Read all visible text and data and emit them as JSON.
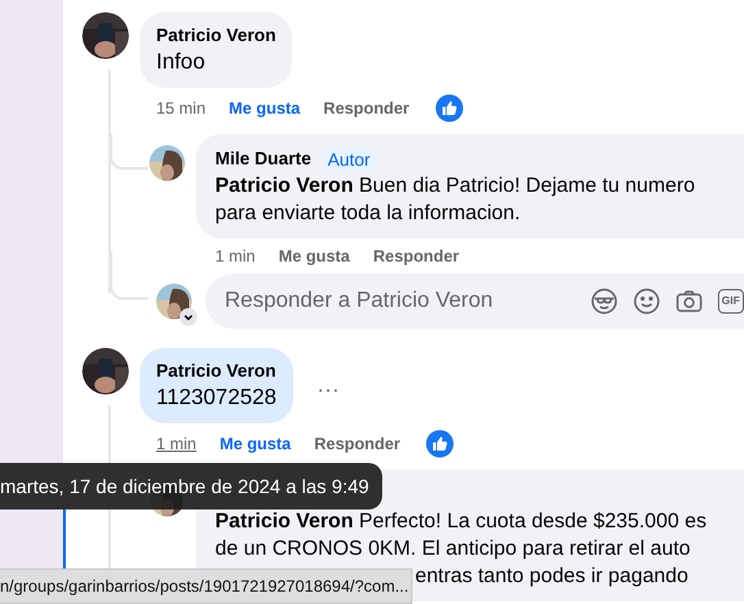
{
  "comments": [
    {
      "author": "Patricio Veron",
      "text": "Infoo",
      "highlighted": false,
      "time": "15 min",
      "time_hovered": false,
      "like_label": "Me gusta",
      "liked": true,
      "reply_label": "Responder",
      "reaction": true,
      "replies": [
        {
          "author": "Mile Duarte",
          "badge": "Autor",
          "lines": [
            "**Patricio Veron** Buen dia Patricio! Dejame tu numero",
            "para enviarte toda la informacion."
          ],
          "time": "1 min",
          "like_label": "Me gusta",
          "liked": false,
          "reply_label": "Responder"
        }
      ],
      "reply_field": {
        "placeholder": "Responder a Patricio Veron",
        "icons": [
          {
            "kind": "sticker"
          },
          {
            "kind": "emoji"
          },
          {
            "kind": "camera"
          },
          {
            "kind": "gif",
            "label": "GIF"
          }
        ]
      }
    },
    {
      "author": "Patricio Veron",
      "text": "1123072528",
      "highlighted": true,
      "more_label": "...",
      "time": "1 min",
      "time_hovered": true,
      "like_label": "Me gusta",
      "liked": true,
      "reply_label": "Responder",
      "reaction": true,
      "replies": [
        {
          "lines": [
            "**Patricio Veron** Perfecto! La cuota desde $235.000 es",
            "de un CRONOS 0KM. El anticipo para retirar el auto",
            "entras tanto podes ir pagando"
          ],
          "partially_covered": true
        }
      ]
    }
  ],
  "tooltip": {
    "text": "martes, 17 de diciembre de 2024 a las 9:49"
  },
  "status_bar": {
    "url": "n/groups/garinbarrios/posts/1901721927018694/?com..."
  }
}
